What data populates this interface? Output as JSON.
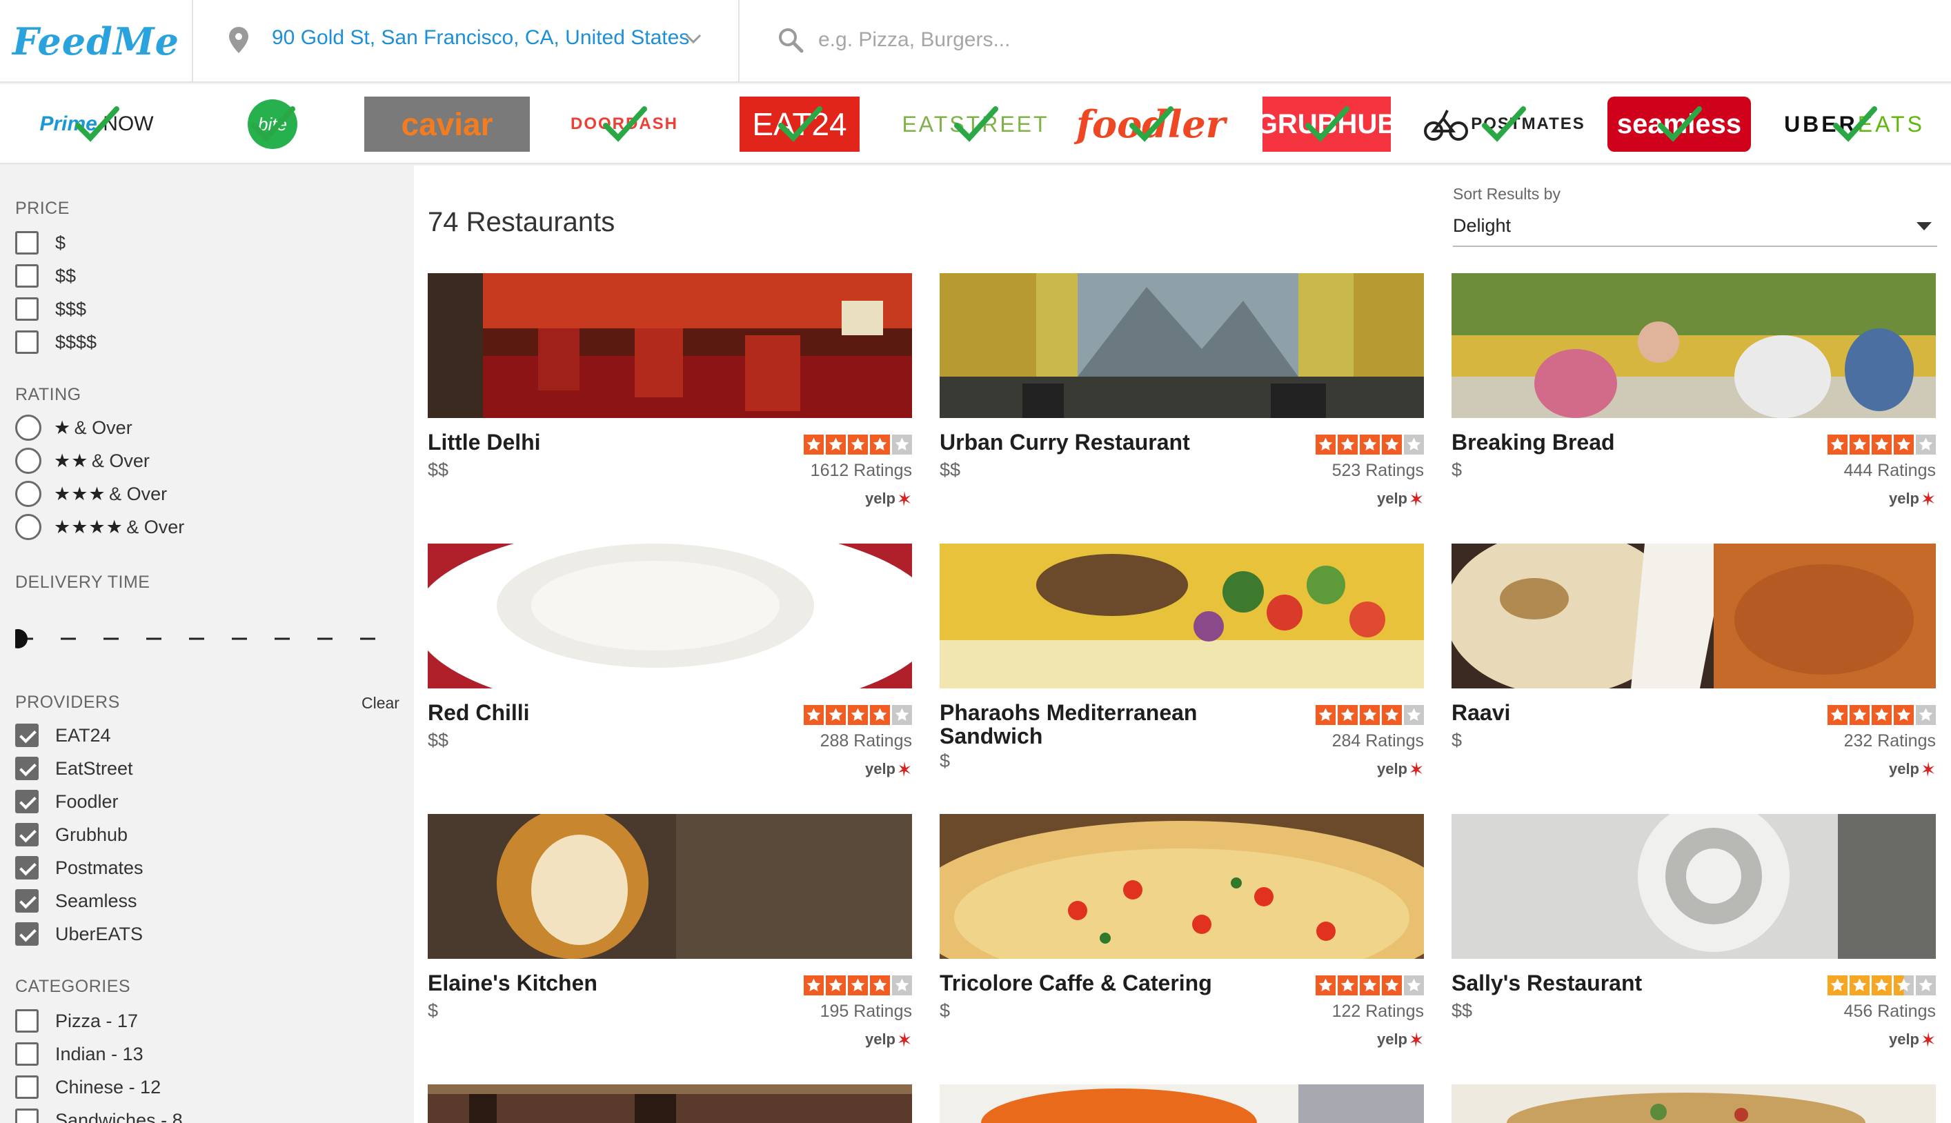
{
  "header": {
    "logo": "FeedMe",
    "location": "90 Gold St, San Francisco, CA, United States",
    "search_placeholder": "e.g. Pizza, Burgers..."
  },
  "providers": [
    {
      "name": "PrimeNow",
      "label": "Prime NOW",
      "checked": true
    },
    {
      "name": "Bite Squad",
      "label": "bite",
      "checked": true
    },
    {
      "name": "Caviar",
      "label": "caviar",
      "checked": false
    },
    {
      "name": "DoorDash",
      "label": "DOORDASH",
      "checked": true
    },
    {
      "name": "EAT24",
      "label": "EAT24",
      "checked": true
    },
    {
      "name": "EatStreet",
      "label": "EATSTREET",
      "checked": true
    },
    {
      "name": "Foodler",
      "label": "foodler",
      "checked": true
    },
    {
      "name": "Grubhub",
      "label": "GRUBHUB",
      "checked": true
    },
    {
      "name": "Postmates",
      "label": "POSTMATES",
      "checked": true
    },
    {
      "name": "Seamless",
      "label": "seamless",
      "checked": true
    },
    {
      "name": "UberEATS",
      "label": "UBEREATS",
      "checked": true
    }
  ],
  "filters": {
    "price": {
      "title": "PRICE",
      "options": [
        "$",
        "$$",
        "$$$",
        "$$$$"
      ]
    },
    "rating": {
      "title": "RATING",
      "options": [
        {
          "stars": "★",
          "suffix": "& Over"
        },
        {
          "stars": "★★",
          "suffix": "& Over"
        },
        {
          "stars": "★★★",
          "suffix": "& Over"
        },
        {
          "stars": "★★★★",
          "suffix": "& Over"
        }
      ]
    },
    "delivery_time": {
      "title": "DELIVERY TIME",
      "value_fraction": 0
    },
    "providers": {
      "title": "PROVIDERS",
      "clear_label": "Clear",
      "options": [
        {
          "label": "EAT24",
          "checked": true
        },
        {
          "label": "EatStreet",
          "checked": true
        },
        {
          "label": "Foodler",
          "checked": true
        },
        {
          "label": "Grubhub",
          "checked": true
        },
        {
          "label": "Postmates",
          "checked": true
        },
        {
          "label": "Seamless",
          "checked": true
        },
        {
          "label": "UberEATS",
          "checked": true
        }
      ]
    },
    "categories": {
      "title": "CATEGORIES",
      "options": [
        "Pizza - 17",
        "Indian - 13",
        "Chinese - 12",
        "Sandwiches - 8"
      ]
    }
  },
  "results": {
    "count_label": "74 Restaurants",
    "sort_label": "Sort Results by",
    "sort_value": "Delight"
  },
  "restaurants": [
    {
      "name": "Little Delhi",
      "price": "$$",
      "rating": 4,
      "ratings": "1612 Ratings",
      "photo": "restaurant-interior"
    },
    {
      "name": "Urban Curry Restaurant",
      "price": "$$",
      "rating": 4,
      "ratings": "523 Ratings",
      "photo": "restaurant-interior"
    },
    {
      "name": "Breaking Bread",
      "price": "$",
      "rating": 4,
      "ratings": "444 Ratings",
      "photo": "outdoor-patio"
    },
    {
      "name": "Red Chilli",
      "price": "$$",
      "rating": 4,
      "ratings": "288 Ratings",
      "photo": "rice-plate"
    },
    {
      "name": "Pharaohs Mediterranean Sandwich",
      "price": "$",
      "rating": 4,
      "ratings": "284 Ratings",
      "photo": "kebab-salad"
    },
    {
      "name": "Raavi",
      "price": "$",
      "rating": 4,
      "ratings": "232 Ratings",
      "photo": "naan-biryani"
    },
    {
      "name": "Elaine's Kitchen",
      "price": "$",
      "rating": 4,
      "ratings": "195 Ratings",
      "photo": "fried-food"
    },
    {
      "name": "Tricolore Caffe & Catering",
      "price": "$",
      "rating": 4,
      "ratings": "122 Ratings",
      "photo": "pizza"
    },
    {
      "name": "Sally's Restaurant",
      "price": "$$",
      "rating": 3.5,
      "ratings": "456 Ratings",
      "photo": "sculpture"
    }
  ],
  "yelp_label": "yelp",
  "colors": {
    "brand": "#2aa2dd",
    "location": "#1d8fd6",
    "yelp_star": "#f15c22",
    "check": "#2aa845"
  }
}
